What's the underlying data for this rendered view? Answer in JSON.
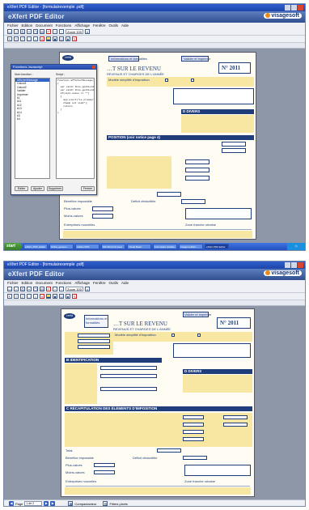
{
  "app": {
    "window_title": "eXfert PDF Editor - [formulairexemple .pdf]",
    "brand_name": "eXfert PDF Editor",
    "logo_text": "visagesoft",
    "tab_label": "formulairexemple .pdf",
    "menu": [
      "Fichier",
      "Edition",
      "Document",
      "Fonctions",
      "Affichage",
      "Fenêtre",
      "Outils",
      "Aide"
    ],
    "zoom_value": "Zoom 100",
    "page_label": "Page",
    "page_box_1": "1 de 2",
    "page_box_2": "1 de 2"
  },
  "taskbar": {
    "start_label": "start",
    "items": [
      "eXfert_PDF_Editor",
      "fichier_genera...",
      "Adobe PDF",
      "MS Word (3) avec",
      "Visual Basic",
      "Formulaire (Adobe...",
      "Image1-eXfert...",
      "eXfert PDF Editor"
    ],
    "active_index": 7,
    "statusbar_items": [
      "Compactacteur",
      "Filtres pixels"
    ]
  },
  "dialog": {
    "title": "Fonctions Javascript",
    "functions_label": "Nom fonction :",
    "script_label": "Script :",
    "functions": [
      "AfficherMessage",
      "Calcul1",
      "Calcul2",
      "Valider",
      "Imprimer",
      "k1",
      "k11",
      "k12",
      "k13",
      "k14",
      "k3",
      "k4"
    ],
    "selected_index": 0,
    "script_lines": [
      "function afficherMessage()",
      "{",
      "  var val1= this.getField(\"champ1\");",
      "  var val2= this.getField(\"champ2\");",
      "",
      "  if(val1.value == \"\")",
      "  {",
      "    app.alert(\"Le premier",
      "    champ est vide\");",
      "    return;",
      "  }",
      "}"
    ],
    "buttons": {
      "edit": "Editer",
      "add": "Ajouter",
      "delete": "Supprimer",
      "close": "Fermer"
    }
  },
  "form": {
    "cerfa": "cerfa",
    "title_line1": "…T SUR LE REVENU",
    "title_line2": "REVENUS ET CHARGES DE L'ANNÉE",
    "form_number": "N° 2011",
    "top_button_1": "Informations et formalités",
    "top_button_2": "Valider et imprimer",
    "declare_label": "Réservé à l'administration",
    "cerfa_label": "Modèle simplifié d'imposition",
    "section_divers": "D DIVERS",
    "section_position": "POSITION (voir notice page 4)",
    "section_full": "C RÉCAPITULATION DES ÉLÉMENTS D'IMPOSITION",
    "section_identification": "B IDENTIFICATION",
    "total_label": "Total",
    "benefice_label": "Bénéfice imposable",
    "deficit_label": "Déficit déductible",
    "plus_values_label": "Plus-values",
    "moins_values_label": "Moins-values",
    "entreprises_label": "Entreprises nouvelles",
    "zone_label": "Zone franche urbaine"
  }
}
